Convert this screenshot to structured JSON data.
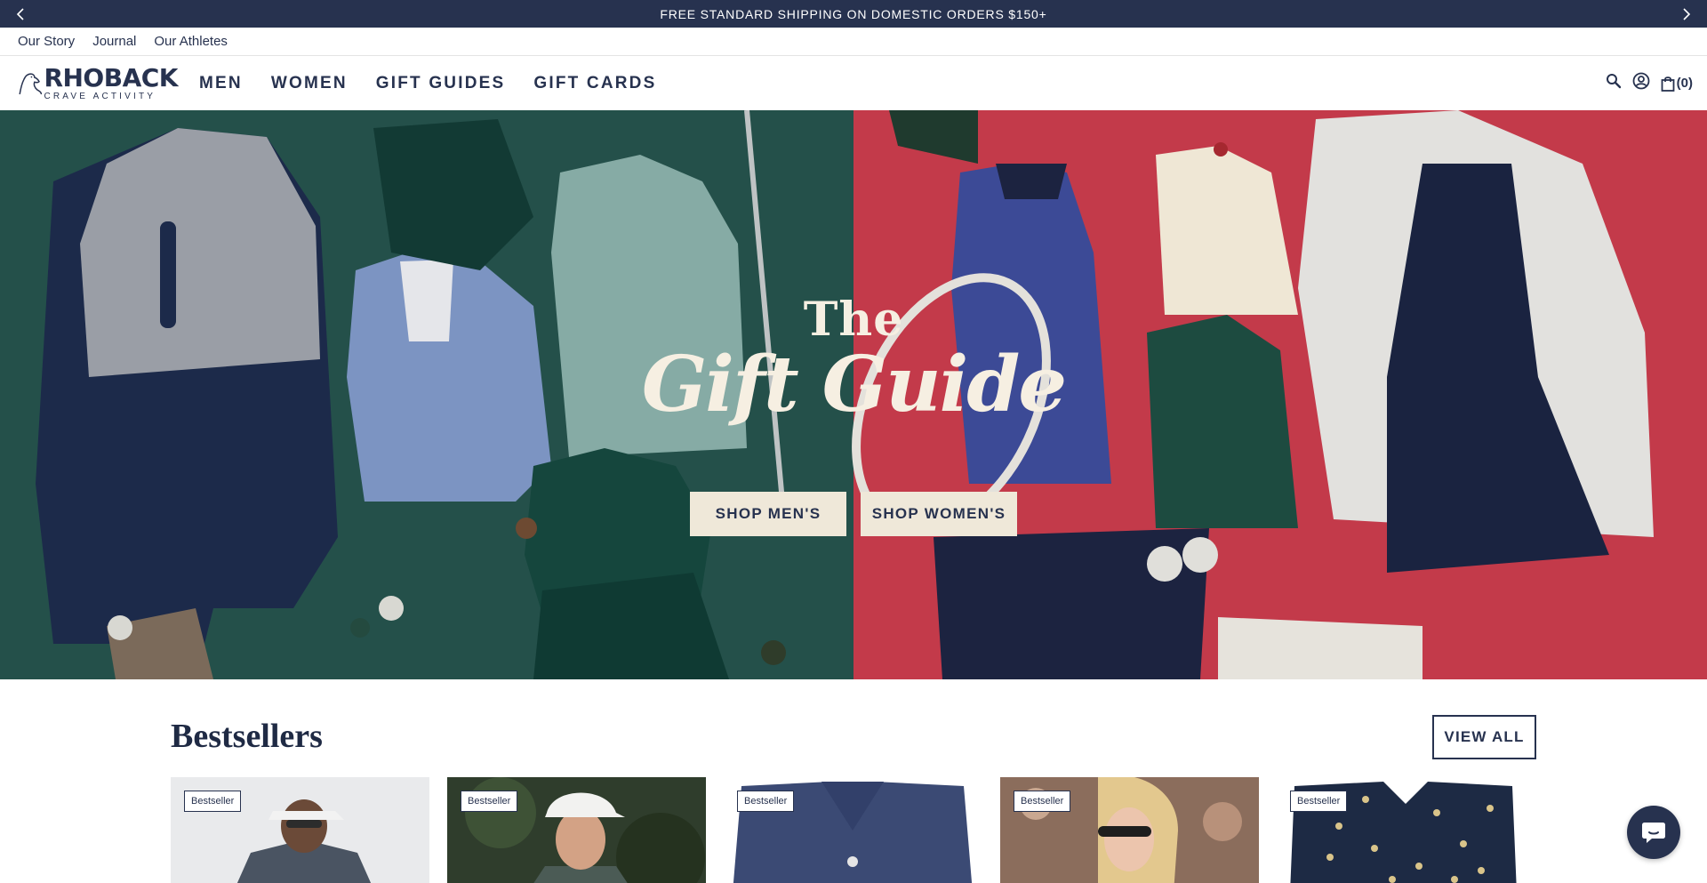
{
  "announcement": {
    "text": "FREE STANDARD SHIPPING ON DOMESTIC ORDERS $150+",
    "prev_icon": "chevron-left-icon",
    "next_icon": "chevron-right-icon"
  },
  "utility_nav": {
    "items": [
      "Our Story",
      "Journal",
      "Our Athletes"
    ]
  },
  "header": {
    "logo_brand": "RHOBACK",
    "logo_tagline": "CRAVE ACTIVITY",
    "nav": [
      "MEN",
      "WOMEN",
      "GIFT GUIDES",
      "GIFT CARDS"
    ],
    "cart_count": "(0)",
    "icons": [
      "search-icon",
      "account-icon",
      "bag-icon"
    ]
  },
  "hero": {
    "title_line1": "The",
    "title_line2": "Gift Guide",
    "buttons": [
      "SHOP MEN'S",
      "SHOP WOMEN'S"
    ],
    "colors": {
      "left_bg": "#234d45",
      "right_bg": "#c33a4a",
      "text": "#f6efe2",
      "button_bg": "#efe8d9"
    }
  },
  "bestsellers": {
    "title": "Bestsellers",
    "view_all": "VIEW ALL",
    "products": [
      {
        "badge": "Bestseller"
      },
      {
        "badge": "Bestseller"
      },
      {
        "badge": "Bestseller"
      },
      {
        "badge": "Bestseller"
      },
      {
        "badge": "Bestseller"
      }
    ]
  },
  "chat": {
    "icon": "chat-bubble-icon"
  },
  "colors": {
    "brand_navy": "#27324f"
  }
}
